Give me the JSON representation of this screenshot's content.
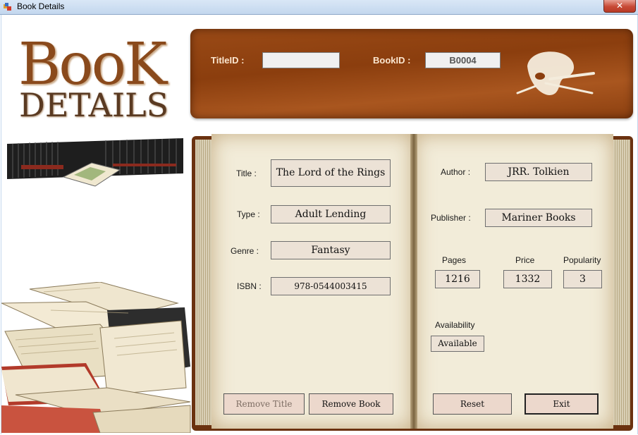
{
  "window": {
    "title": "Book Details",
    "close_glyph": "✕"
  },
  "logo": {
    "line1": "BooK",
    "line2": "DETAILS"
  },
  "header": {
    "title_id_label": "TitleID  :",
    "title_id_value": "",
    "book_id_label": "BookID  :",
    "book_id_value": "B0004"
  },
  "left_page": {
    "title_label": "Title  :",
    "title_value": "The Lord of the Rings",
    "type_label": "Type  :",
    "type_value": "Adult Lending",
    "genre_label": "Genre  :",
    "genre_value": "Fantasy",
    "isbn_label": "ISBN  :",
    "isbn_value": "978-0544003415"
  },
  "right_page": {
    "author_label": "Author  :",
    "author_value": "JRR. Tolkien",
    "publisher_label": "Publisher  :",
    "publisher_value": "Mariner Books",
    "pages_label": "Pages",
    "pages_value": "1216",
    "price_label": "Price",
    "price_value": "1332",
    "popularity_label": "Popularity",
    "popularity_value": "3",
    "availability_label": "Availability",
    "availability_value": "Available"
  },
  "buttons": {
    "remove_title": "Remove Title",
    "remove_book": "Remove Book",
    "reset": "Reset",
    "exit": "Exit"
  },
  "icons": [
    "window-app-icon",
    "close-icon",
    "palette-icon",
    "encyclopedia-books-image",
    "open-books-stack-image"
  ]
}
